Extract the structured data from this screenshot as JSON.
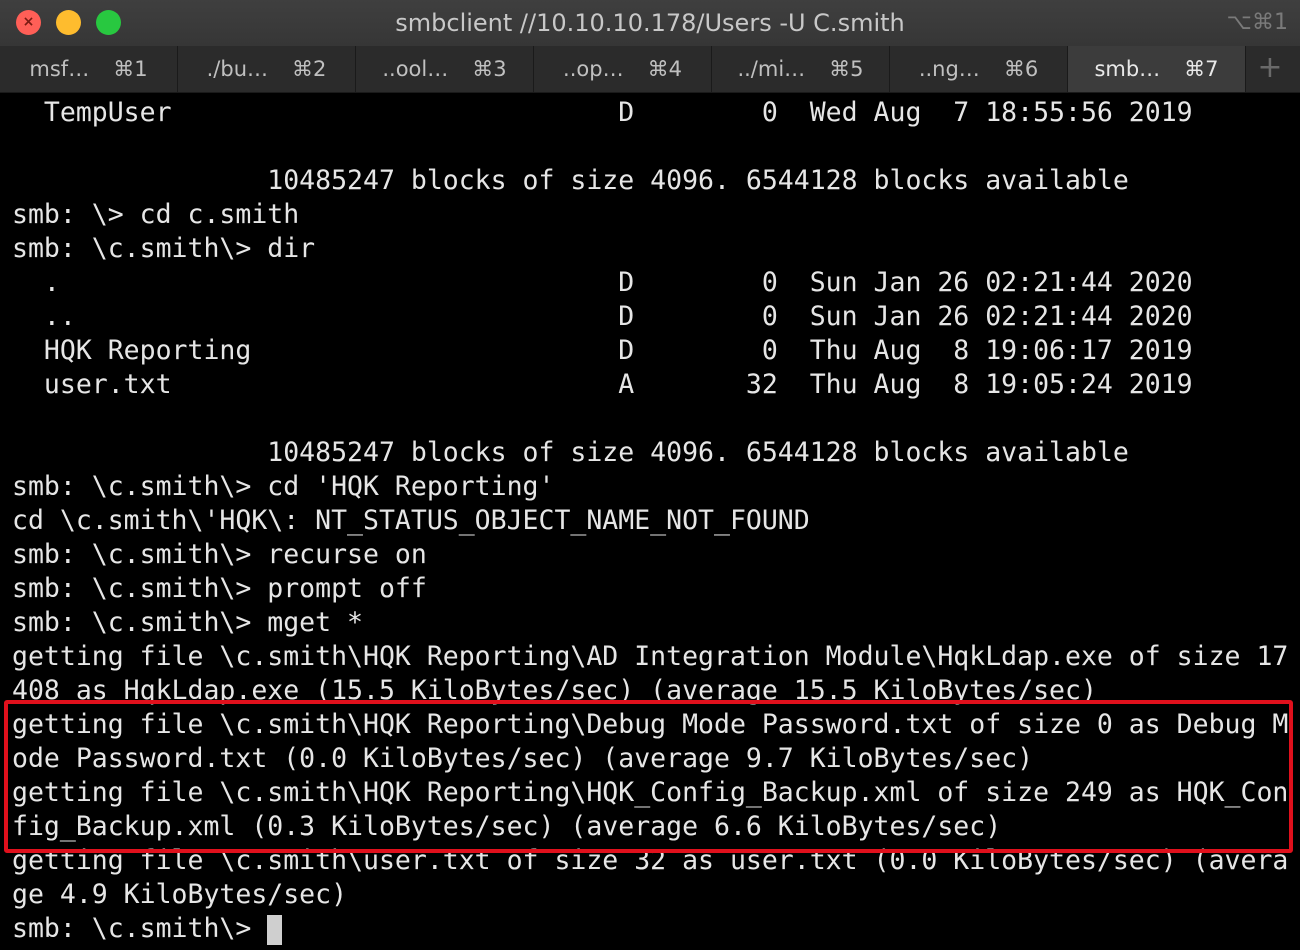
{
  "window": {
    "title": "smbclient //10.10.10.178/Users -U C.smith",
    "shortcut": "⌥⌘1",
    "close_glyph": "×",
    "min_glyph": "",
    "max_glyph": ""
  },
  "tabs": [
    {
      "label": "msf…",
      "shortcut": "⌘1",
      "active": false
    },
    {
      "label": "./bu…",
      "shortcut": "⌘2",
      "active": false
    },
    {
      "label": "..ool…",
      "shortcut": "⌘3",
      "active": false
    },
    {
      "label": "..op…",
      "shortcut": "⌘4",
      "active": false
    },
    {
      "label": "../mi…",
      "shortcut": "⌘5",
      "active": false
    },
    {
      "label": "..ng…",
      "shortcut": "⌘6",
      "active": false
    },
    {
      "label": "smb…",
      "shortcut": "⌘7",
      "active": true
    }
  ],
  "tab_add_label": "+",
  "terminal": {
    "lines": [
      "  TempUser                            D        0  Wed Aug  7 18:55:56 2019",
      "",
      "                10485247 blocks of size 4096. 6544128 blocks available",
      "smb: \\> cd c.smith",
      "smb: \\c.smith\\> dir",
      "  .                                   D        0  Sun Jan 26 02:21:44 2020",
      "  ..                                  D        0  Sun Jan 26 02:21:44 2020",
      "  HQK Reporting                       D        0  Thu Aug  8 19:06:17 2019",
      "  user.txt                            A       32  Thu Aug  8 19:05:24 2019",
      "",
      "                10485247 blocks of size 4096. 6544128 blocks available",
      "smb: \\c.smith\\> cd 'HQK Reporting'",
      "cd \\c.smith\\'HQK\\: NT_STATUS_OBJECT_NAME_NOT_FOUND",
      "smb: \\c.smith\\> recurse on",
      "smb: \\c.smith\\> prompt off",
      "smb: \\c.smith\\> mget *",
      "getting file \\c.smith\\HQK Reporting\\AD Integration Module\\HqkLdap.exe of size 17",
      "408 as HqkLdap.exe (15.5 KiloBytes/sec) (average 15.5 KiloBytes/sec)",
      "getting file \\c.smith\\HQK Reporting\\Debug Mode Password.txt of size 0 as Debug M",
      "ode Password.txt (0.0 KiloBytes/sec) (average 9.7 KiloBytes/sec)",
      "getting file \\c.smith\\HQK Reporting\\HQK_Config_Backup.xml of size 249 as HQK_Con",
      "fig_Backup.xml (0.3 KiloBytes/sec) (average 6.6 KiloBytes/sec)",
      "getting file \\c.smith\\user.txt of size 32 as user.txt (0.0 KiloBytes/sec) (avera",
      "ge 4.9 KiloBytes/sec)"
    ],
    "prompt": "smb: \\c.smith\\> "
  },
  "colors": {
    "background": "#000000",
    "text": "#e6e6e6",
    "highlight_box": "#e0101c"
  }
}
